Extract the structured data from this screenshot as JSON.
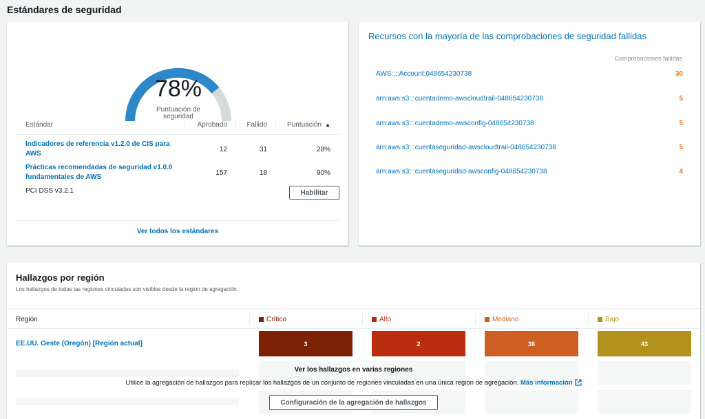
{
  "standards_section": {
    "title": "Estándares de seguridad"
  },
  "score_card": {
    "score_value": "78%",
    "score_fraction": 0.78,
    "score_label_line1": "Puntuación de",
    "score_label_line2": "seguridad",
    "columns": {
      "standard": "Estándar",
      "passed": "Aprobado",
      "failed": "Fallido",
      "score": "Puntuación"
    },
    "rows": [
      {
        "name_line1": "Indicadores de referencia v1.2.0 de CIS para",
        "name_line2": "AWS",
        "passed": "12",
        "failed": "31",
        "score": "28%"
      },
      {
        "name_line1": "Prácticas recomendadas de seguridad v1.0.0",
        "name_line2": "fundamentales de AWS",
        "passed": "157",
        "failed": "18",
        "score": "90%"
      }
    ],
    "disabled_standard": "PCI DSS v3.2.1",
    "enable_label": "Habilitar",
    "view_all_label": "Ver todos los estándares"
  },
  "resources_card": {
    "title": "Recursos con la mayoría de las comprobaciones de seguridad fallidas",
    "column_header": "Comprobaciones fallidas",
    "rows": [
      {
        "resource": "AWS::::Account:048654230738",
        "count": "30"
      },
      {
        "resource": "arn:aws:s3:::cuentademo-awscloudtrail-048654230738",
        "count": "5"
      },
      {
        "resource": "arn:aws:s3:::cuentademo-awsconfig-048654230738",
        "count": "5"
      },
      {
        "resource": "arn:aws:s3:::cuentaseguridad-awscloudtrail-048654230738",
        "count": "5"
      },
      {
        "resource": "arn:aws:s3:::cuentaseguridad-awsconfig-048654230738",
        "count": "4"
      }
    ]
  },
  "regions_card": {
    "title": "Hallazgos por región",
    "subtitle": "Los hallazgos de todas las regiones vinculadas son visibles desde la región de agregación.",
    "columns": {
      "region": "Región",
      "critical": "Crítico",
      "high": "Alto",
      "medium": "Mediano",
      "low": "Bajo"
    },
    "region_name": "EE.UU. Oeste (Oregón) [Región actual]",
    "counts": {
      "critical": "3",
      "high": "2",
      "medium": "36",
      "low": "43"
    },
    "overlay_title": "Ver los hallazgos en varias regiones",
    "overlay_text": "Utilice la agregación de hallazgos para replicar los hallazgos de un conjunto de regiones vinculadas en una única región de agregación.",
    "overlay_link": "Más información",
    "overlay_button": "Configuración de la agregación de hallazgos"
  },
  "colors": {
    "gauge_fill": "#2e87c8",
    "gauge_track": "#d5dbdb",
    "critical": "#7d2105",
    "high": "#ba2e0f",
    "medium": "#cc5f21",
    "low": "#b2911c",
    "link": "#0073bb",
    "count": "#ec7211"
  }
}
